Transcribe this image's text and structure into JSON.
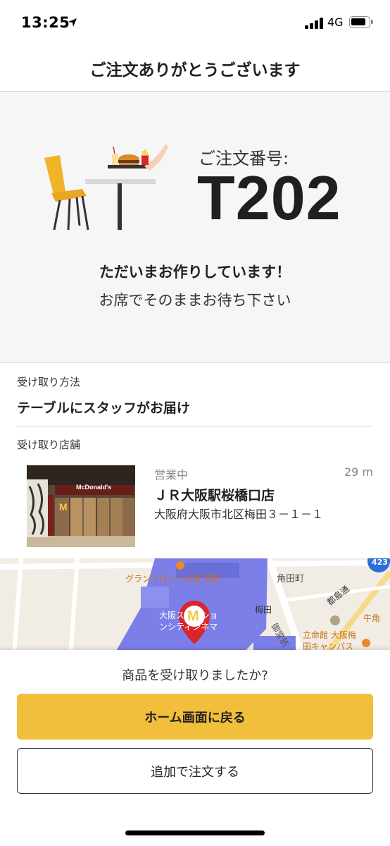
{
  "status_bar": {
    "time": "13:25",
    "network": "4G"
  },
  "nav": {
    "title": "ご注文ありがとうございます"
  },
  "order": {
    "label": "ご注文番号:",
    "number": "T202",
    "status_main": "ただいまお作りしています！",
    "status_sub": "お席でそのままお待ち下さい"
  },
  "pickup": {
    "method_label": "受け取り方法",
    "method_value": "テーブルにスタッフがお届け",
    "store_label": "受け取り店舗"
  },
  "store": {
    "sign": "McDonald's",
    "open_status": "営業中",
    "distance": "29 m",
    "name": "ＪＲ大阪駅桜橋口店",
    "address": "大阪府大阪市北区梅田３－１－１"
  },
  "map": {
    "labels": {
      "grand_front": "グランフロント大阪 南館",
      "kakudacho": "角田町",
      "umeda": "梅田",
      "miyakojima_dori": "都島通",
      "osaka_station_1": "大阪ステーショ",
      "osaka_station_2": "ンシティシネマ",
      "midosuji": "御堂筋",
      "gyukaku": "牛角",
      "ritsumeikan_1": "立命館 大阪梅",
      "ritsumeikan_2": "田キャンパス",
      "route_badge": "423",
      "marker_letter": "M"
    },
    "colors": {
      "station_area": "#7c7fe8",
      "marker": "#d8262c",
      "route_badge": "#2a6fd6"
    }
  },
  "sheet": {
    "question": "商品を受け取りましたか?",
    "primary_button": "ホーム画面に戻る",
    "secondary_button": "追加で注文する"
  },
  "colors": {
    "accent": "#f2bf3c",
    "chair": "#f0b429"
  }
}
